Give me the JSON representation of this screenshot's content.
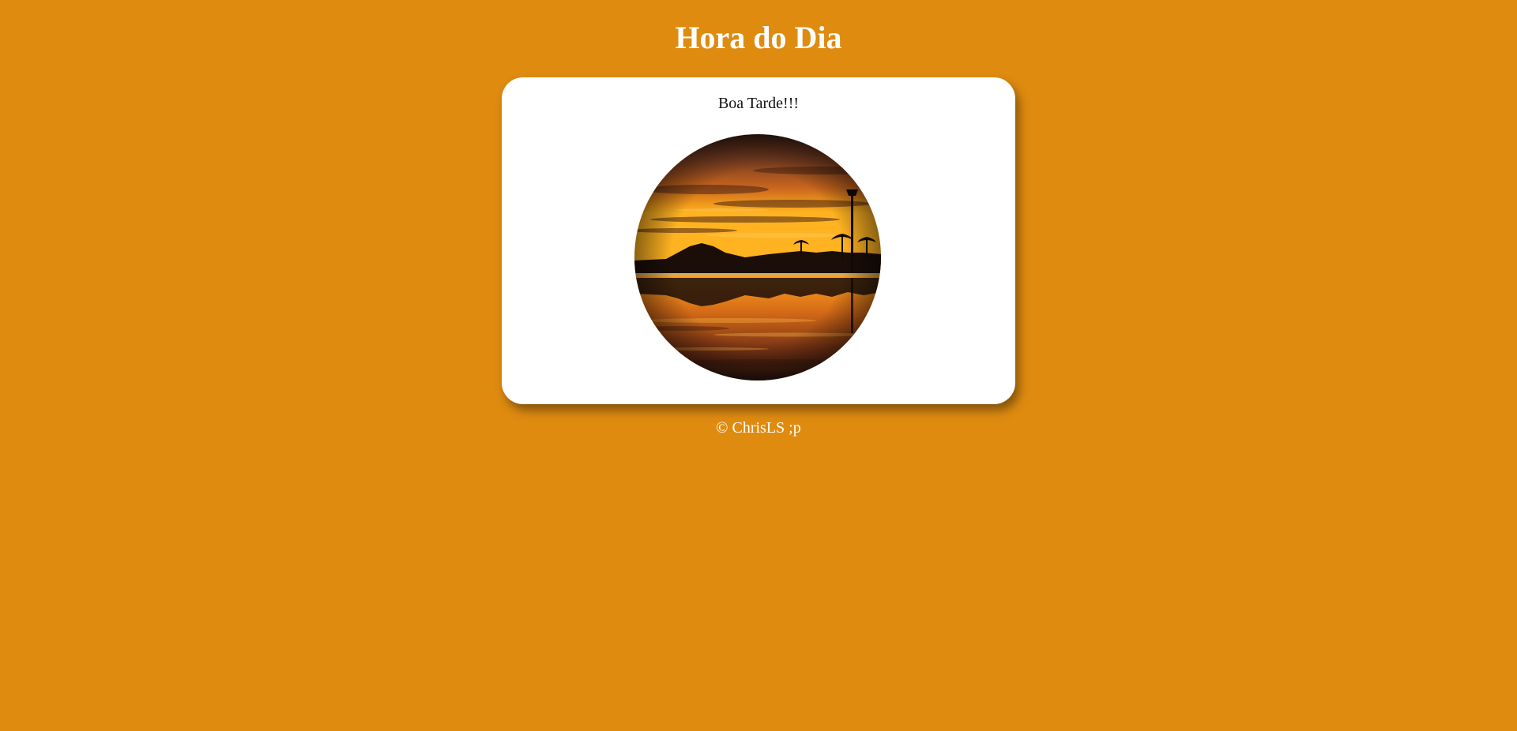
{
  "header": {
    "title": "Hora do Dia"
  },
  "card": {
    "greeting": "Boa Tarde!!!",
    "image": {
      "subject": "sunset-reflection-photo",
      "shape": "circle"
    }
  },
  "footer": {
    "text": "© ChrisLS ;p"
  },
  "colors": {
    "page_background": "#df8b10",
    "card_background": "#ffffff",
    "title_text": "#ffffff",
    "greeting_text": "#111111",
    "footer_text": "#ffffff"
  }
}
